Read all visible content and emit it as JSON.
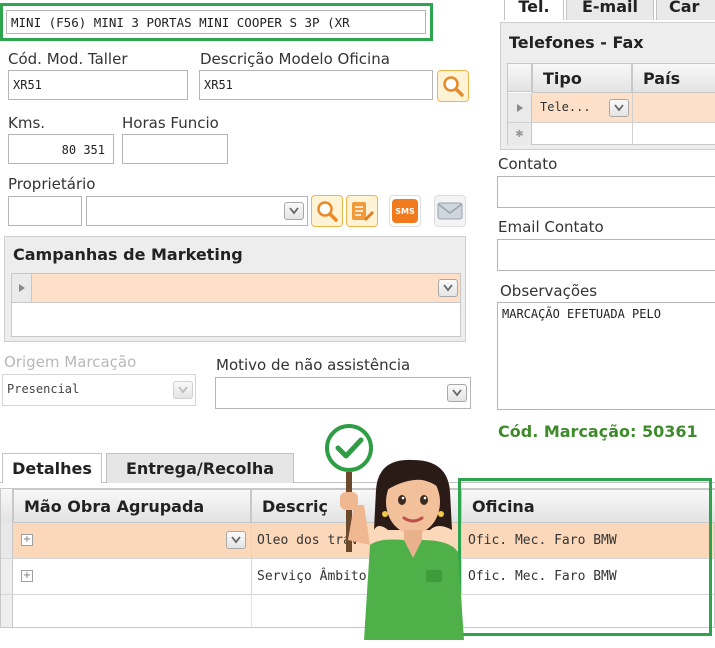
{
  "model_field": "MINI (F56) MINI 3 PORTAS MINI COOPER S 3P (XR",
  "cod_mod": {
    "label": "Cód. Mod. Taller",
    "value": "XR51"
  },
  "desc_modelo": {
    "label": "Descrição Modelo Oficina",
    "value": "XR51"
  },
  "kms": {
    "label": "Kms.",
    "value": "80 351"
  },
  "horas": {
    "label": "Horas Funcio",
    "value": ""
  },
  "proprietario": {
    "label": "Proprietário",
    "sms": "SMS"
  },
  "campanhas": {
    "title": "Campanhas de Marketing"
  },
  "origem": {
    "label": "Origem Marcação",
    "value": "Presencial"
  },
  "motivo": {
    "label": "Motivo de não assistência",
    "value": ""
  },
  "right_tabs": [
    "Tel.",
    "E-mail",
    "Car"
  ],
  "telefones": {
    "title": "Telefones - Fax",
    "columns": [
      "Tipo",
      "País"
    ],
    "row_tipo": "Tele..."
  },
  "contato": {
    "label": "Contato",
    "value": ""
  },
  "email_contato": {
    "label": "Email Contato",
    "value": ""
  },
  "observacoes": {
    "label": "Observações",
    "value": "MARCAÇÃO EFETUADA PELO"
  },
  "cod_marcacao": "Cód. Marcação: 50361",
  "bottom_tabs": [
    "Detalhes",
    "Entrega/Recolha"
  ],
  "grid": {
    "columns": [
      "Mão Obra Agrupada",
      "Descriç",
      "Oficina"
    ],
    "rows": [
      {
        "descricao": "Oleo dos trav",
        "oficina": "Ofic. Mec. Faro BMW"
      },
      {
        "descricao": "Serviço Âmbito",
        "oficina": "Ofic. Mec. Faro BMW"
      }
    ]
  },
  "colors": {
    "accent_green": "#2ea44f",
    "selected_row": "#fde0c7",
    "search_orange": "#f6a03a",
    "cod_marcacao": "#3e8b2c"
  }
}
